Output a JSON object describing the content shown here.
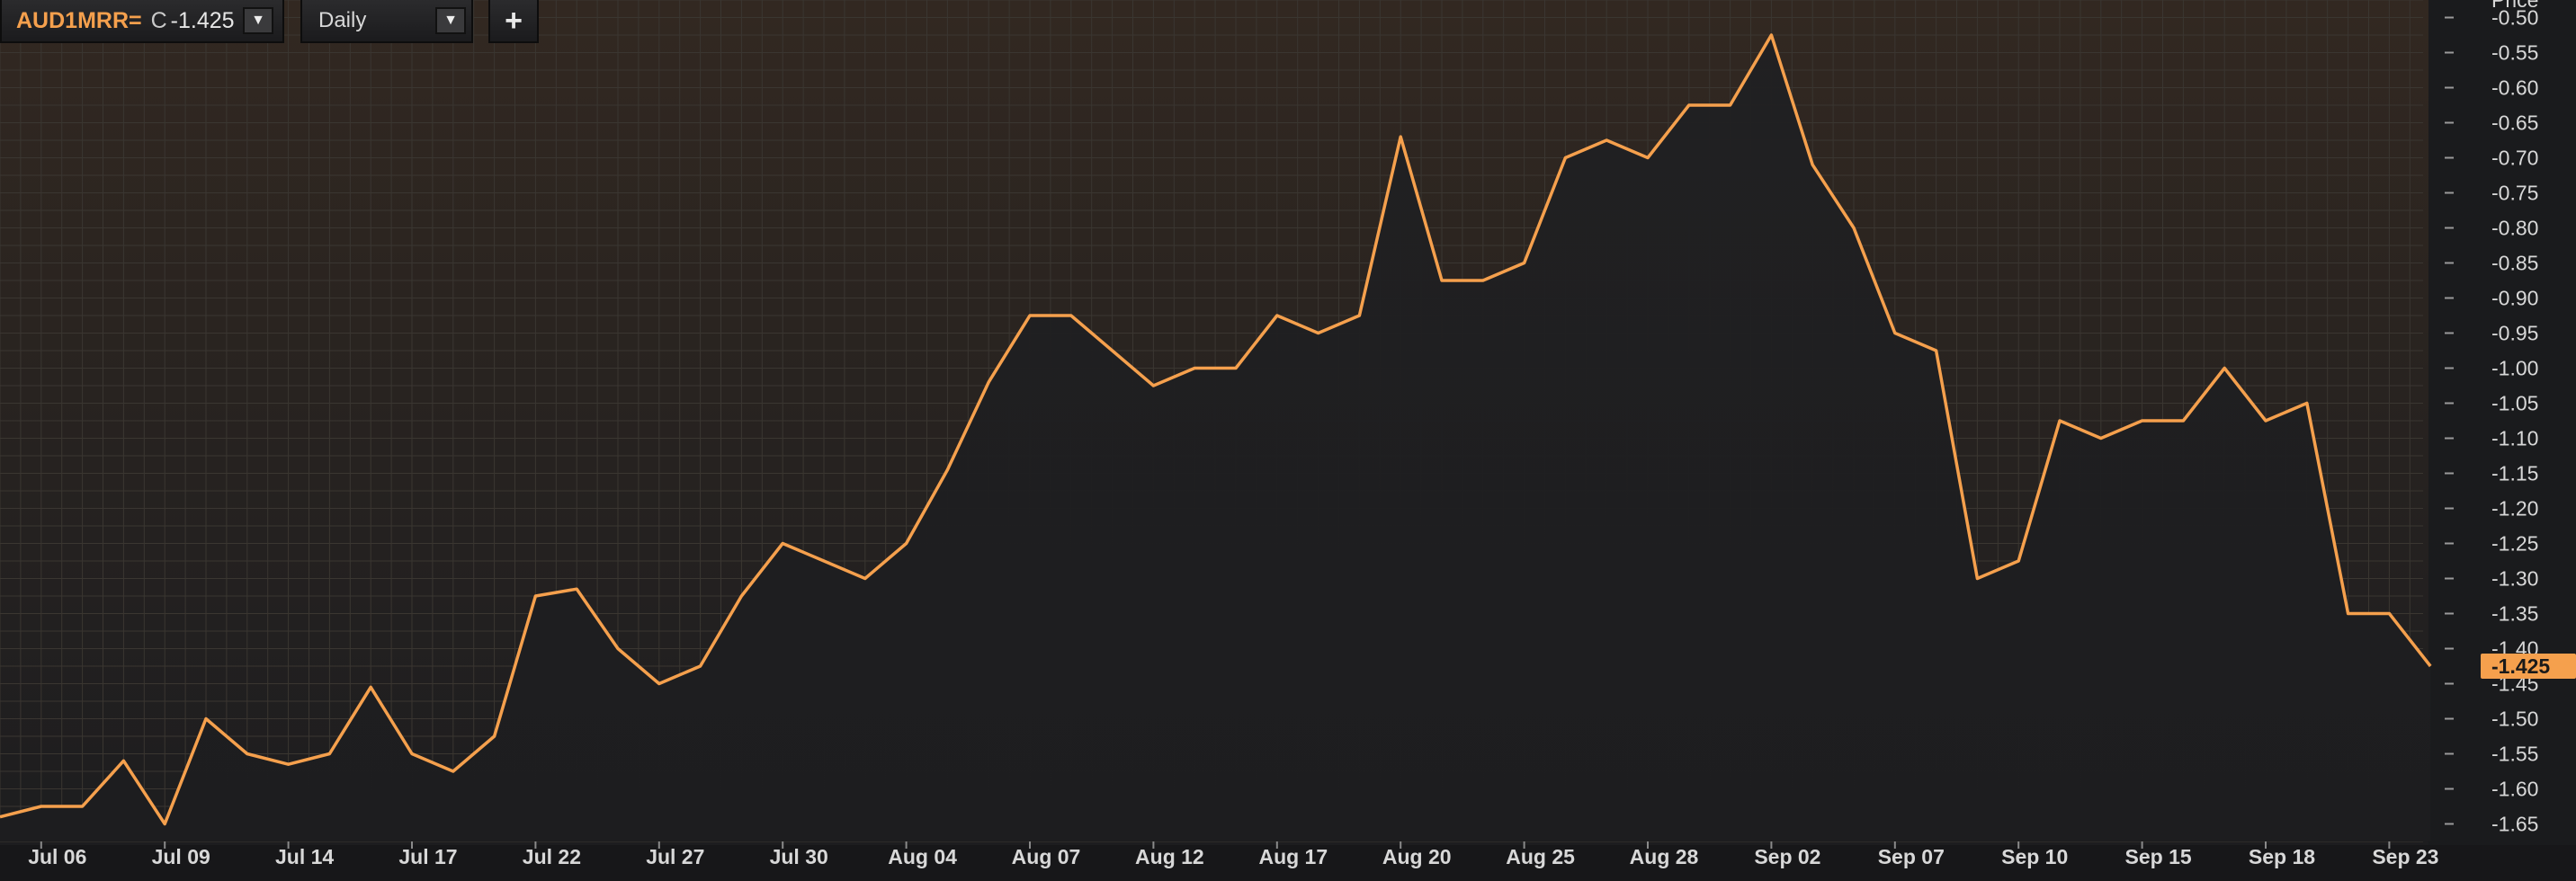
{
  "toolbar": {
    "symbol": "AUD1MRR=",
    "close_label": "C",
    "close_value": "-1.425",
    "interval": "Daily",
    "add_label": "+",
    "dropdown_icon": "▼"
  },
  "colors": {
    "line": "#f5a04d",
    "last_badge": "#f5a04d",
    "background": "#1c1c1e",
    "grid": "#3a3631"
  },
  "chart_data": {
    "type": "line",
    "title": "",
    "xlabel": "",
    "ylabel": "Price",
    "ylim": [
      -1.675,
      -0.475
    ],
    "y_ticks": [
      "-0.50",
      "-0.55",
      "-0.60",
      "-0.65",
      "-0.70",
      "-0.75",
      "-0.80",
      "-0.85",
      "-0.90",
      "-0.95",
      "-1.00",
      "-1.05",
      "-1.10",
      "-1.15",
      "-1.20",
      "-1.25",
      "-1.30",
      "-1.35",
      "-1.40",
      "-1.45",
      "-1.50",
      "-1.55",
      "-1.60",
      "-1.65"
    ],
    "x_ticks": [
      {
        "label": "Jul 06",
        "index": 1
      },
      {
        "label": "Jul 09",
        "index": 4
      },
      {
        "label": "Jul 14",
        "index": 7
      },
      {
        "label": "Jul 17",
        "index": 10
      },
      {
        "label": "Jul 22",
        "index": 13
      },
      {
        "label": "Jul 27",
        "index": 16
      },
      {
        "label": "Jul 30",
        "index": 19
      },
      {
        "label": "Aug 04",
        "index": 22
      },
      {
        "label": "Aug 07",
        "index": 25
      },
      {
        "label": "Aug 12",
        "index": 28
      },
      {
        "label": "Aug 17",
        "index": 31
      },
      {
        "label": "Aug 20",
        "index": 34
      },
      {
        "label": "Aug 25",
        "index": 37
      },
      {
        "label": "Aug 28",
        "index": 40
      },
      {
        "label": "Sep 02",
        "index": 43
      },
      {
        "label": "Sep 07",
        "index": 46
      },
      {
        "label": "Sep 10",
        "index": 49
      },
      {
        "label": "Sep 15",
        "index": 52
      },
      {
        "label": "Sep 18",
        "index": 55
      },
      {
        "label": "Sep 23",
        "index": 58
      }
    ],
    "series": [
      {
        "values": [
          -1.64,
          -1.625,
          -1.625,
          -1.56,
          -1.65,
          -1.5,
          -1.55,
          -1.565,
          -1.55,
          -1.455,
          -1.55,
          -1.575,
          -1.525,
          -1.325,
          -1.315,
          -1.4,
          -1.45,
          -1.425,
          -1.325,
          -1.25,
          -1.275,
          -1.3,
          -1.25,
          -1.145,
          -1.02,
          -0.925,
          -0.925,
          -0.975,
          -1.025,
          -1.0,
          -1.0,
          -0.925,
          -0.95,
          -0.925,
          -0.67,
          -0.875,
          -0.875,
          -0.85,
          -0.7,
          -0.675,
          -0.7,
          -0.625,
          -0.625,
          -0.525,
          -0.71,
          -0.8,
          -0.95,
          -0.975,
          -1.3,
          -1.275,
          -1.075,
          -1.1,
          -1.075,
          -1.075,
          -1.0,
          -1.075,
          -1.05,
          -1.35,
          -1.35,
          -1.425
        ]
      }
    ],
    "last_value": "-1.425"
  }
}
